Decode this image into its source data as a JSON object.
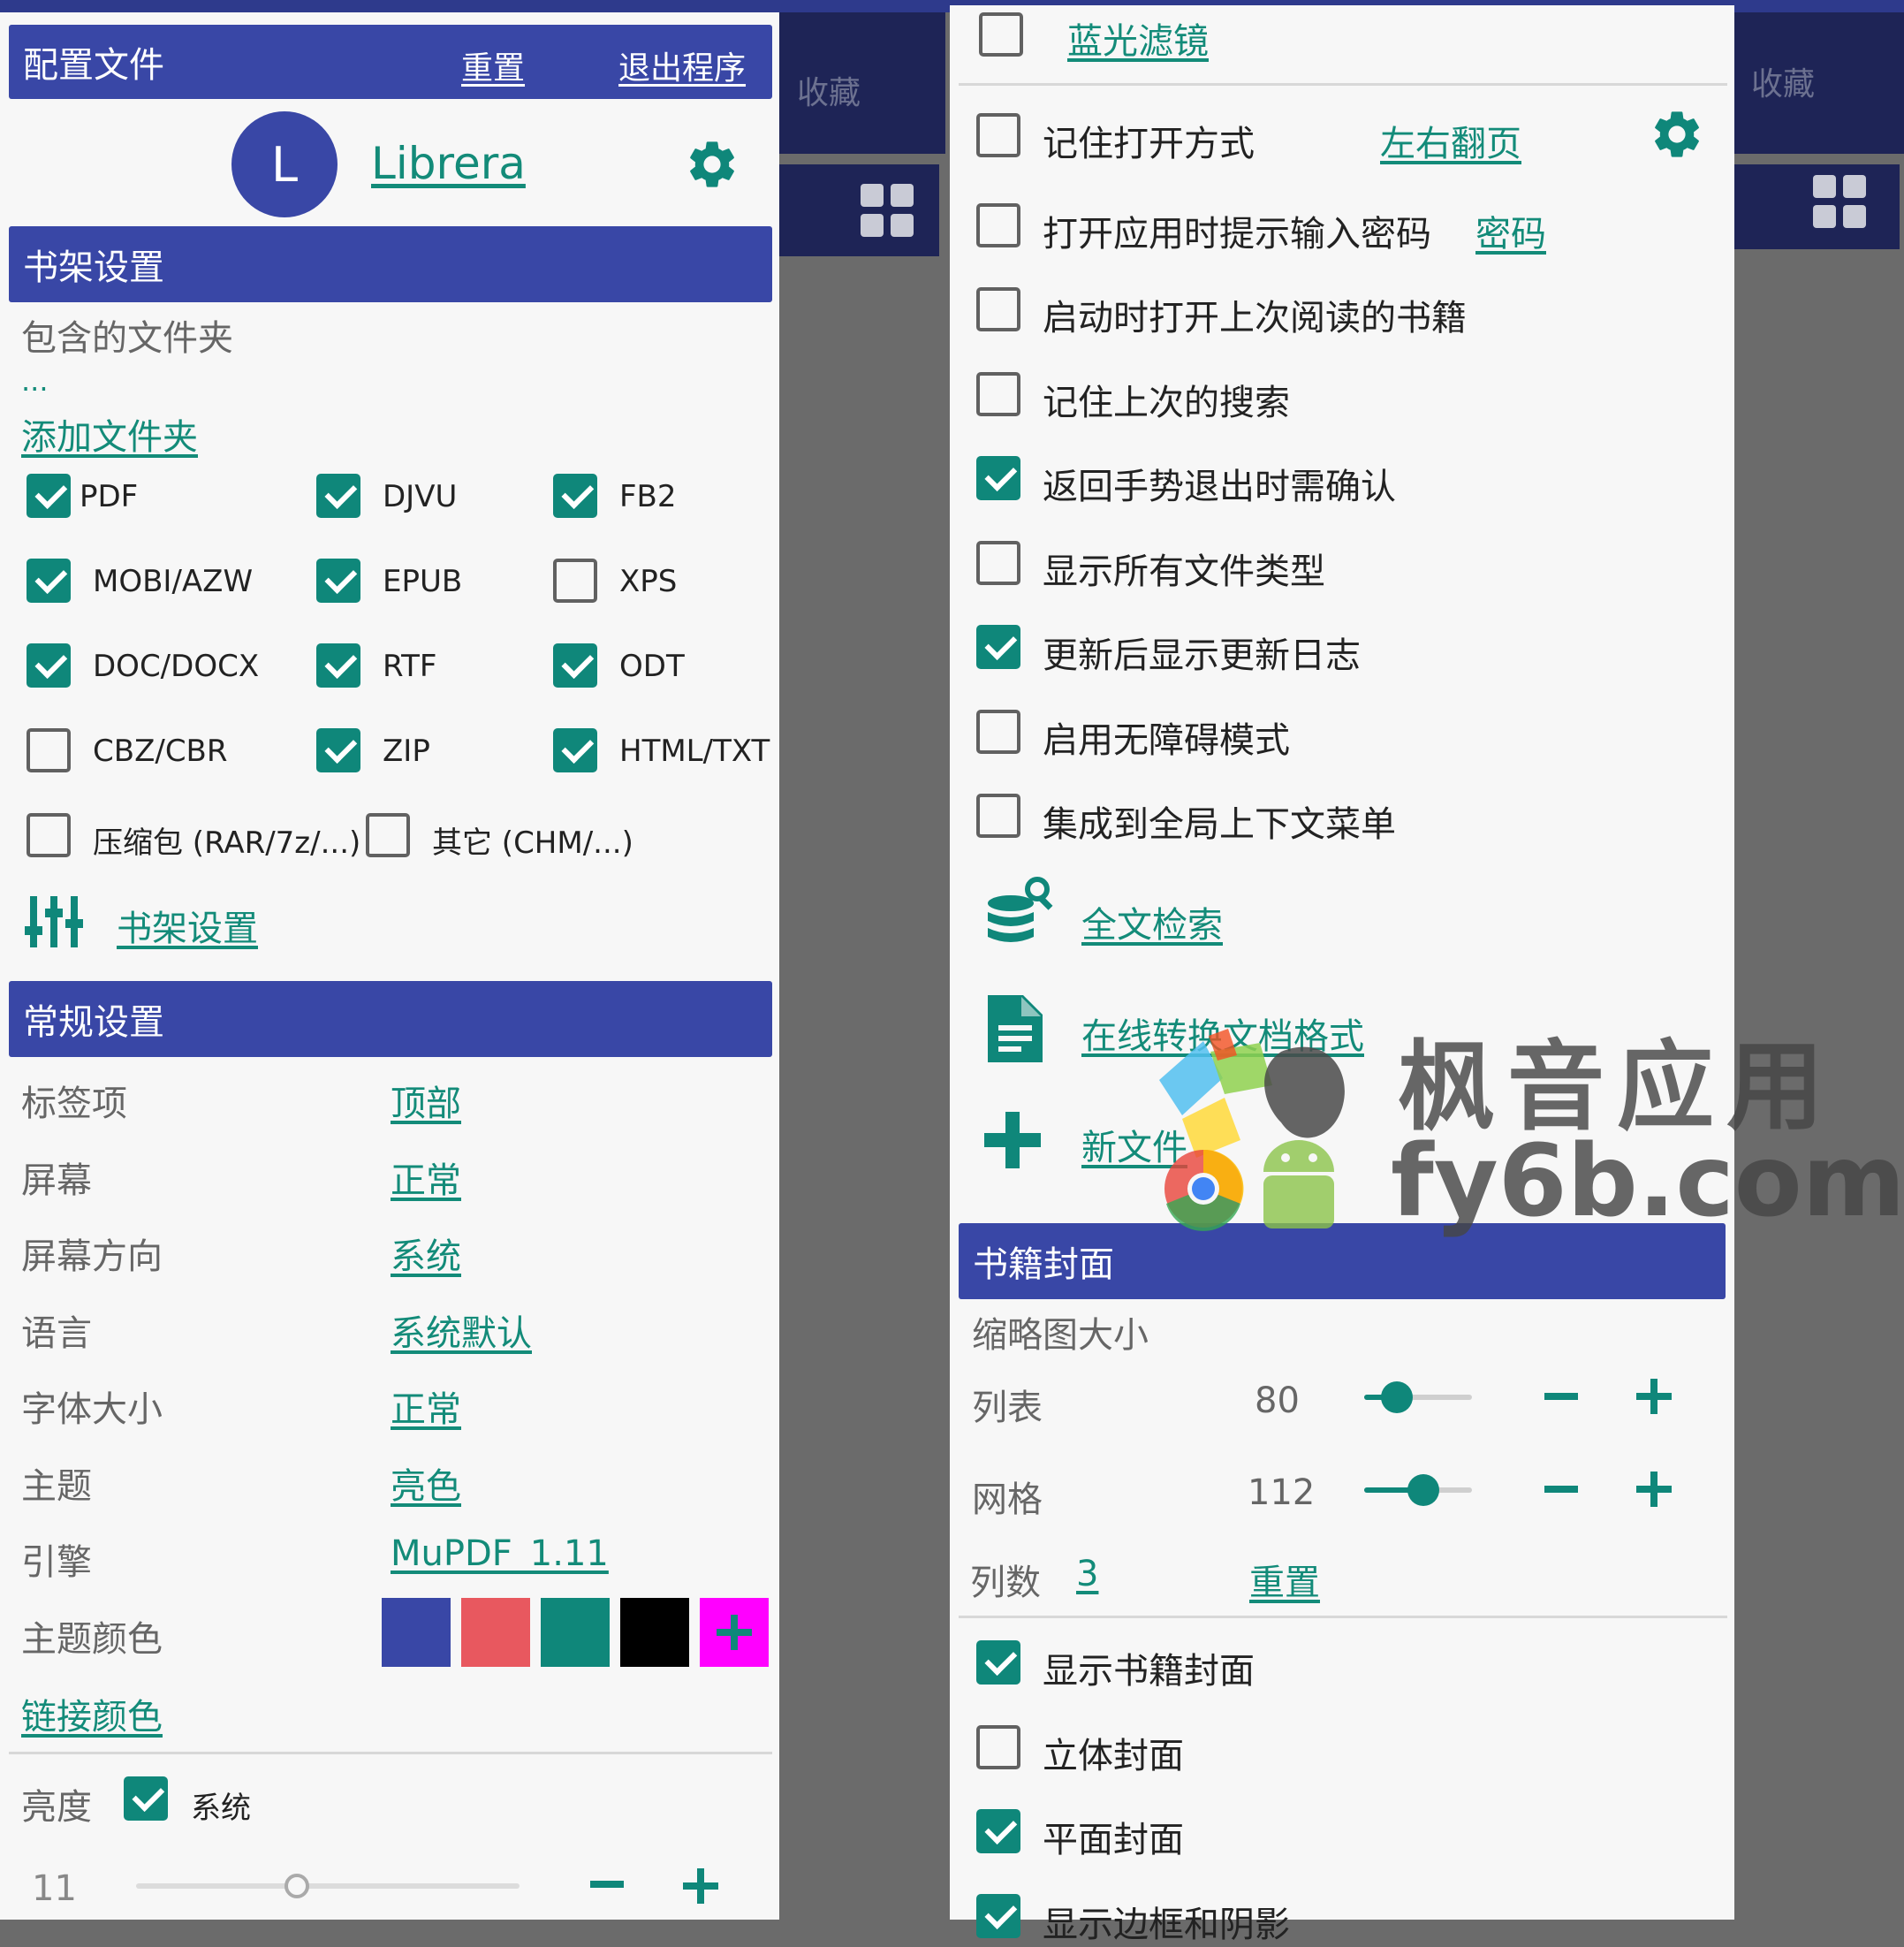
{
  "colors": {
    "primary": "#3947a6",
    "accent": "#0f877a",
    "red": "#e8585f",
    "black": "#000000",
    "magenta": "#ff00ff"
  },
  "bg_app": {
    "fav_label": "收藏"
  },
  "left": {
    "profile_header": {
      "title": "配置文件",
      "reset": "重置",
      "exit": "退出程序"
    },
    "profile": {
      "avatar_letter": "L",
      "name": "Librera"
    },
    "shelf_header": "书架设置",
    "folders_label": "包含的文件夹",
    "folders_value": "...",
    "add_folder": "添加文件夹",
    "formats": [
      {
        "label": "PDF",
        "checked": true
      },
      {
        "label": "DJVU",
        "checked": true
      },
      {
        "label": "FB2",
        "checked": true
      },
      {
        "label": "MOBI/AZW",
        "checked": true
      },
      {
        "label": "EPUB",
        "checked": true
      },
      {
        "label": "XPS",
        "checked": false
      },
      {
        "label": "DOC/DOCX",
        "checked": true
      },
      {
        "label": "RTF",
        "checked": true
      },
      {
        "label": "ODT",
        "checked": true
      },
      {
        "label": "CBZ/CBR",
        "checked": false
      },
      {
        "label": "ZIP",
        "checked": true
      },
      {
        "label": "HTML/TXT",
        "checked": true
      },
      {
        "label": "压缩包 (RAR/7z/...)",
        "checked": false
      },
      {
        "label": "其它 (CHM/...)",
        "checked": false
      }
    ],
    "shelf_settings_link": "书架设置",
    "general_header": "常规设置",
    "settings": [
      {
        "label": "标签项",
        "value": "顶部"
      },
      {
        "label": "屏幕",
        "value": "正常"
      },
      {
        "label": "屏幕方向",
        "value": "系统"
      },
      {
        "label": "语言",
        "value": "系统默认"
      },
      {
        "label": "字体大小",
        "value": "正常"
      },
      {
        "label": "主题",
        "value": "亮色"
      },
      {
        "label": "引擎",
        "value": "MuPDF_1.11"
      }
    ],
    "theme_color_label": "主题颜色",
    "link_color": "链接颜色",
    "brightness": {
      "label": "亮度",
      "system_label": "系统",
      "system_checked": true,
      "value": "11",
      "level_percent": 42
    }
  },
  "right": {
    "blue_filter": {
      "label": "蓝光滤镜",
      "checked": false
    },
    "options": [
      {
        "label": "记住打开方式",
        "checked": false,
        "link": "左右翻页"
      },
      {
        "label": "打开应用时提示输入密码",
        "checked": false,
        "link": "密码"
      },
      {
        "label": "启动时打开上次阅读的书籍",
        "checked": false
      },
      {
        "label": "记住上次的搜索",
        "checked": false
      },
      {
        "label": "返回手势退出时需确认",
        "checked": true
      },
      {
        "label": "显示所有文件类型",
        "checked": false
      },
      {
        "label": "更新后显示更新日志",
        "checked": true
      },
      {
        "label": "启用无障碍模式",
        "checked": false
      },
      {
        "label": "集成到全局上下文菜单",
        "checked": false
      }
    ],
    "actions": {
      "fulltext": "全文检索",
      "convert": "在线转换文档格式",
      "new_file": "新文件"
    },
    "cover_header": "书籍封面",
    "thumb_size_label": "缩略图大小",
    "list": {
      "label": "列表",
      "value": "80",
      "level_percent": 30
    },
    "grid": {
      "label": "网格",
      "value": "112",
      "level_percent": 55
    },
    "columns": {
      "label": "列数",
      "value": "3",
      "reset": "重置"
    },
    "cover_options": [
      {
        "label": "显示书籍封面",
        "checked": true
      },
      {
        "label": "立体封面",
        "checked": false
      },
      {
        "label": "平面封面",
        "checked": true
      },
      {
        "label": "显示边框和阴影",
        "checked": true
      }
    ]
  },
  "watermark": {
    "brand": "枫音应用",
    "domain": "fy6b.com"
  }
}
